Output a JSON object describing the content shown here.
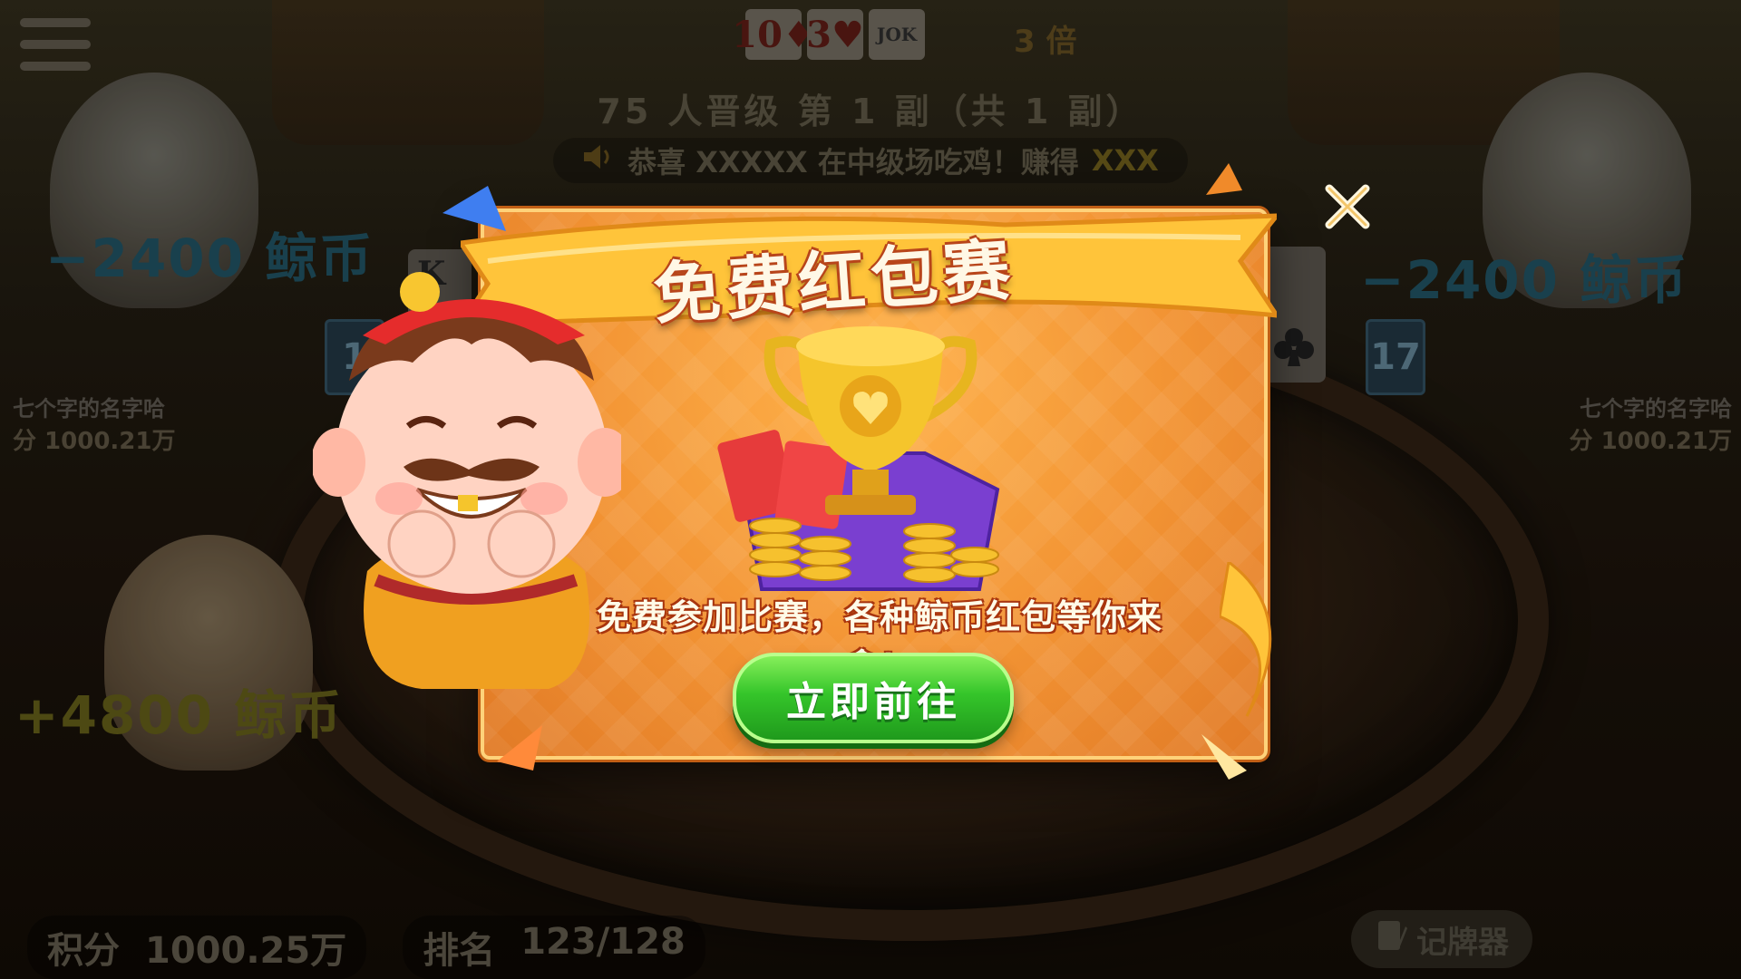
{
  "game": {
    "top_cards": [
      "10♦",
      "3♥",
      "JOK"
    ],
    "multiplier": "3 倍",
    "stage_info": "75 人晋级  第 1 副（共 1 副）",
    "broadcast": {
      "prefix": "恭喜 XXXXX 在中级场吃鸡！赚得",
      "highlight": "XXX"
    },
    "left_player": {
      "coin_delta": "−2400 鲸币",
      "name": "七个字的名字哈",
      "score": "分 1000.21万",
      "card_count": "1"
    },
    "right_player": {
      "coin_delta": "−2400 鲸币",
      "name": "七个字的名字哈",
      "score": "分 1000.21万",
      "card_count": "17"
    },
    "self_player": {
      "coin_delta": "+4800 鲸币"
    },
    "bottom_bar": {
      "points_label": "积分",
      "points_value": "1000.25万",
      "rank_label": "排名",
      "rank_value": "123/128"
    },
    "recorder_label": "记牌器",
    "left_card_letter": "K"
  },
  "modal": {
    "title": "免费红包赛",
    "description": "免费参加比赛，各种鲸币红包等你来拿！",
    "go_button": "立即前往"
  },
  "colors": {
    "modal_orange": "#f29333",
    "ribbon_gold": "#ffc43a",
    "button_green": "#35c52a",
    "title_stroke": "#b8451a"
  },
  "icons": {
    "close": "close-icon",
    "menu": "menu-icon",
    "speaker": "speaker-icon",
    "recorder": "notebook-icon",
    "club": "club-suit-icon"
  }
}
